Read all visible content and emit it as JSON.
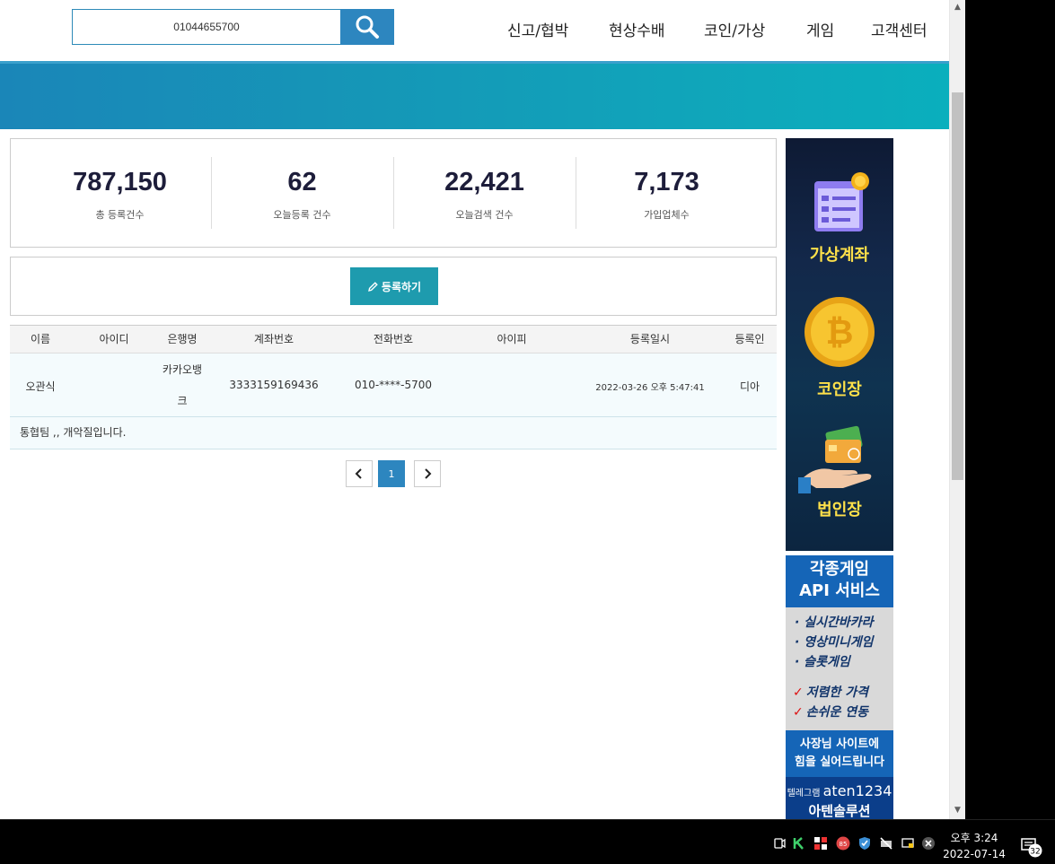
{
  "search": {
    "value": "01044655700"
  },
  "nav": [
    "신고/협박",
    "현상수배",
    "코인/가상",
    "게임",
    "고객센터"
  ],
  "stats": [
    {
      "value": "787,150",
      "label": "총 등록건수"
    },
    {
      "value": "62",
      "label": "오늘등록 건수"
    },
    {
      "value": "22,421",
      "label": "오늘검색 건수"
    },
    {
      "value": "7,173",
      "label": "가입업체수"
    }
  ],
  "register_button": "등록하기",
  "table": {
    "headers": [
      "이름",
      "아이디",
      "은행명",
      "계좌번호",
      "전화번호",
      "아이피",
      "등록일시",
      "등록인"
    ],
    "row": {
      "name": "오관식",
      "id": "",
      "bank_line1": "카카오뱅",
      "bank_line2": "크",
      "account": "3333159169436",
      "phone": "010-****-5700",
      "ip": "",
      "datetime": "2022-03-26 오후 5:47:41",
      "registrant": "디아"
    },
    "memo": "통협팀 ,, 개악질입니다."
  },
  "pagination": {
    "prev": "‹",
    "current": "1",
    "next": "›"
  },
  "ad1": {
    "line1": "가상계좌",
    "line2": "코인장",
    "line3": "법인장"
  },
  "ad2": {
    "title1": "각종게임",
    "title2": "API 서비스",
    "items": [
      "· 실시간바카라",
      "· 영상미니게임",
      "· 슬롯게임"
    ],
    "checks": [
      "저렴한 가격",
      "손쉬운 연동"
    ],
    "mid1": "사장님 사이트에",
    "mid2": "힘을 실어드립니다",
    "contact_prefix": "텔레그램",
    "contact_id": "aten1234",
    "brand": "아텐솔루션"
  },
  "taskbar": {
    "time": "오후 3:24",
    "date": "2022-07-14",
    "notifications": "32",
    "badge": "85"
  },
  "colors": {
    "primary": "#2d86bf",
    "teal_button": "#1e9bae",
    "banner": "#1597b7"
  }
}
